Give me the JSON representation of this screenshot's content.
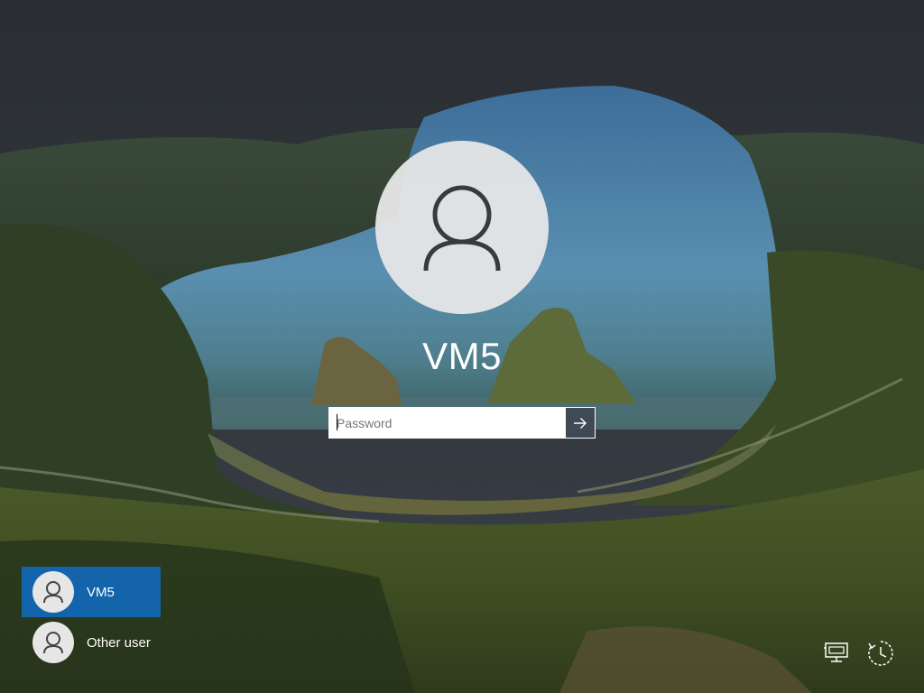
{
  "login": {
    "username": "VM5",
    "password_placeholder": "Password",
    "password_value": ""
  },
  "user_list": [
    {
      "label": "VM5",
      "selected": true
    },
    {
      "label": "Other user",
      "selected": false
    }
  ],
  "icons": {
    "avatar": "user-silhouette-icon",
    "submit": "arrow-right-icon",
    "network": "network-icon",
    "power": "power-icon"
  },
  "colors": {
    "selected_tile": "#1364ab",
    "submit_button": "#3f4a55",
    "text": "#ffffff"
  }
}
